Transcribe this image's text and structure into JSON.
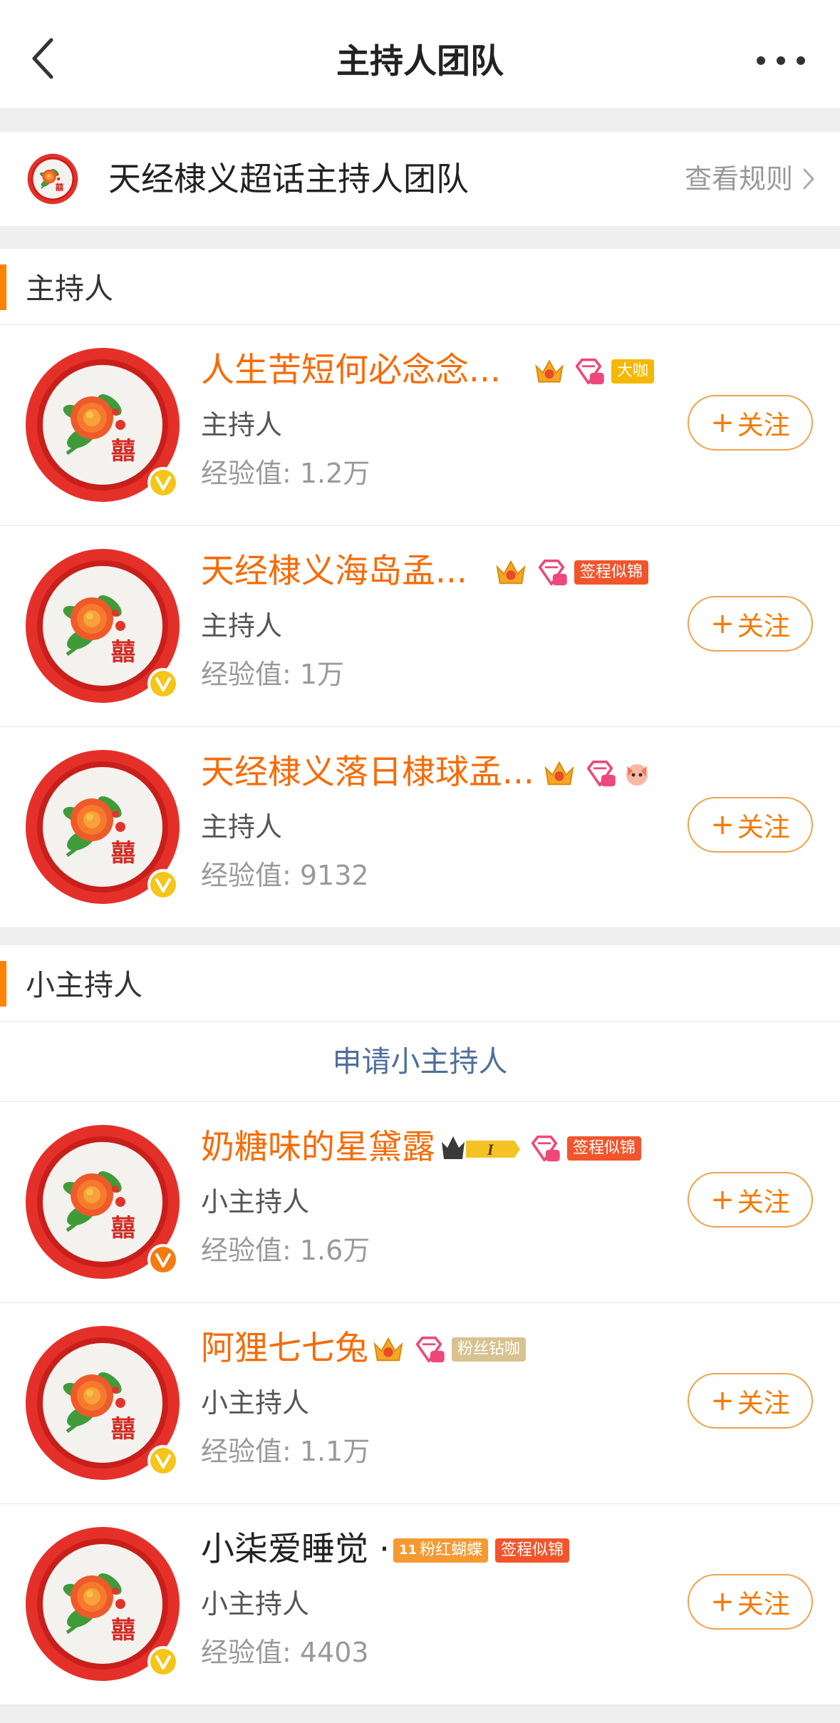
{
  "nav": {
    "title": "主持人团队",
    "back_icon": "chevron-left-icon",
    "more_icon": "more-dots-icon"
  },
  "team": {
    "name": "天经棣义超话主持人团队",
    "rules_label": "查看规则"
  },
  "colors": {
    "accent": "#ff8200",
    "name_orange": "#f76b05",
    "link_blue": "#4e6e9a",
    "verify_gold": "#f5c518",
    "verify_orange": "#f77a0e"
  },
  "hosts_section": {
    "title": "主持人",
    "items": [
      {
        "name": "人生苦短何必念念...",
        "role": "主持人",
        "exp": "经验值: 1.2万",
        "follow": "关注",
        "tag": "大咖",
        "gem": "13",
        "crown": "6"
      },
      {
        "name": "天经棣义海岛孟...",
        "role": "主持人",
        "exp": "经验值: 1万",
        "follow": "关注",
        "tag": "签程似锦",
        "gem": "13",
        "crown": ""
      },
      {
        "name": "天经棣义落日棣球孟...",
        "role": "主持人",
        "exp": "经验值: 9132",
        "follow": "关注",
        "tag": "",
        "gem": "12",
        "crown": ""
      }
    ]
  },
  "small_hosts_section": {
    "title": "小主持人",
    "apply_label": "申请小主持人",
    "items": [
      {
        "name": "奶糖味的星黛露",
        "role": "小主持人",
        "exp": "经验值: 1.6万",
        "follow": "关注",
        "tag": "签程似锦",
        "gem": "13",
        "level": "I"
      },
      {
        "name": "阿狸七七兔",
        "role": "小主持人",
        "exp": "经验值: 1.1万",
        "follow": "关注",
        "tag": "粉丝钻咖",
        "gem": "13"
      },
      {
        "name": "小柒爱睡觉 ·",
        "role": "小主持人",
        "exp": "经验值: 4403",
        "follow": "关注",
        "tag": "签程似锦",
        "tag2": "粉红蝴蝶",
        "butterfly_level": "11"
      }
    ]
  }
}
